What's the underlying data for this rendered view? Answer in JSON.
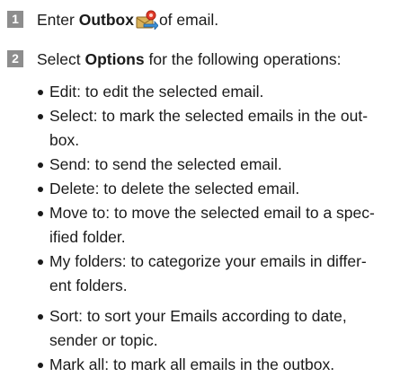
{
  "steps": [
    {
      "number": "1",
      "prefix": "Enter ",
      "bold": "Outbox",
      "icon": "outbox-icon",
      "suffix": "of email."
    },
    {
      "number": "2",
      "prefix": "Select ",
      "bold": "Options",
      "suffix": " for the following operations:"
    }
  ],
  "options": [
    "Edit: to edit the selected email.",
    "Select: to mark the selected emails in the out-",
    "box.",
    "Send: to send the selected email.",
    "Delete: to delete the selected email.",
    "Move to: to move the selected email to a spec-",
    "ified folder.",
    "My folders: to categorize your emails in differ-",
    "ent folders.",
    "Sort: to sort your Emails according to date,",
    "sender or topic.",
    "Mark all: to mark all emails in the outbox."
  ]
}
